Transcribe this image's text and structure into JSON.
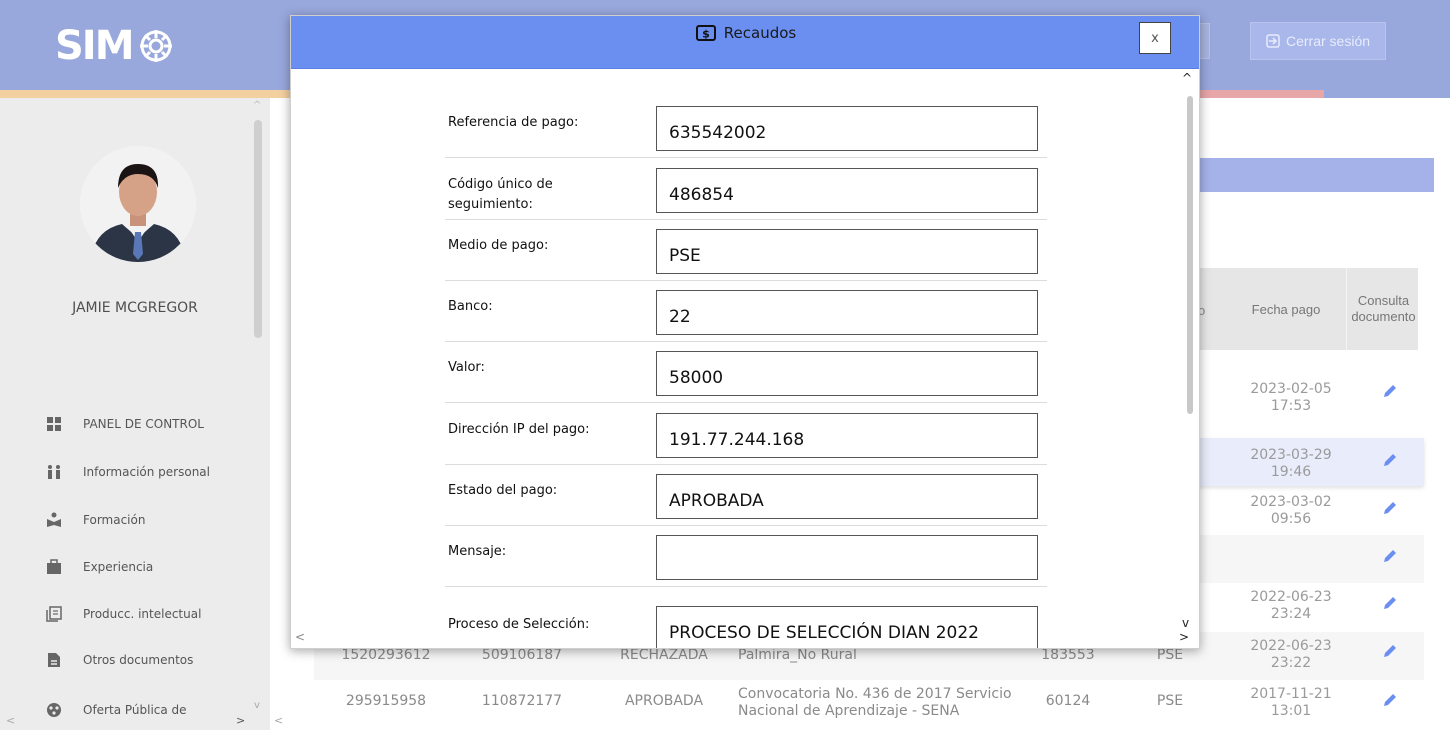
{
  "app": {
    "logo_text": "SIM",
    "logout_label": "Cerrar sesión"
  },
  "user": {
    "name": "JAMIE MCGREGOR"
  },
  "sidebar": {
    "items": [
      {
        "label": "PANEL DE CONTROL",
        "icon": "dashboard-icon"
      },
      {
        "label": "Información personal",
        "icon": "people-icon"
      },
      {
        "label": "Formación",
        "icon": "education-icon"
      },
      {
        "label": "Experiencia",
        "icon": "briefcase-icon"
      },
      {
        "label": "Producc. intelectual",
        "icon": "publication-icon"
      },
      {
        "label": "Otros documentos",
        "icon": "document-icon"
      },
      {
        "label": "Oferta Pública de",
        "icon": "globe-icon"
      }
    ]
  },
  "table": {
    "headers": {
      "partial": "o",
      "fecha_pago": "Fecha pago",
      "consulta": "Consulta documento"
    },
    "rows": [
      {
        "fecha": "2023-02-05 17:53"
      },
      {
        "fecha": "2023-03-29 19:46"
      },
      {
        "fecha": "2023-03-02 09:56"
      },
      {
        "fecha": ""
      },
      {
        "fecha": "2022-06-23 23:24"
      },
      {
        "referencia": "1520293612",
        "codigo": "509106187",
        "estado": "RECHAZADA",
        "proceso": "Secretaria de Educación Municipio de Palmira_No Rural",
        "valor": "183553",
        "medio": "PSE",
        "fecha": "2022-06-23 23:22"
      },
      {
        "referencia": "295915958",
        "codigo": "110872177",
        "estado": "APROBADA",
        "proceso": "Convocatoria No. 436 de 2017 Servicio Nacional de Aprendizaje - SENA",
        "valor": "60124",
        "medio": "PSE",
        "fecha": "2017-11-21 13:01"
      }
    ]
  },
  "modal": {
    "title": "Recaudos",
    "close_label": "x",
    "fields": [
      {
        "label": "Referencia de pago:",
        "value": "635542002"
      },
      {
        "label": "Código único de seguimiento:",
        "value": "486854"
      },
      {
        "label": "Medio de pago:",
        "value": "PSE"
      },
      {
        "label": "Banco:",
        "value": "22"
      },
      {
        "label": "Valor:",
        "value": "58000"
      },
      {
        "label": "Dirección IP del pago:",
        "value": "191.77.244.168"
      },
      {
        "label": "Estado del pago:",
        "value": "APROBADA"
      },
      {
        "label": "Mensaje:",
        "value": ""
      },
      {
        "label": "Proceso de Selección:",
        "value": "PROCESO DE SELECCIÓN DIAN 2022"
      }
    ]
  },
  "colors": {
    "header_blue": "#6b8ff0",
    "topbar": "#98a7dc",
    "sidebar_bg": "#ececec"
  }
}
